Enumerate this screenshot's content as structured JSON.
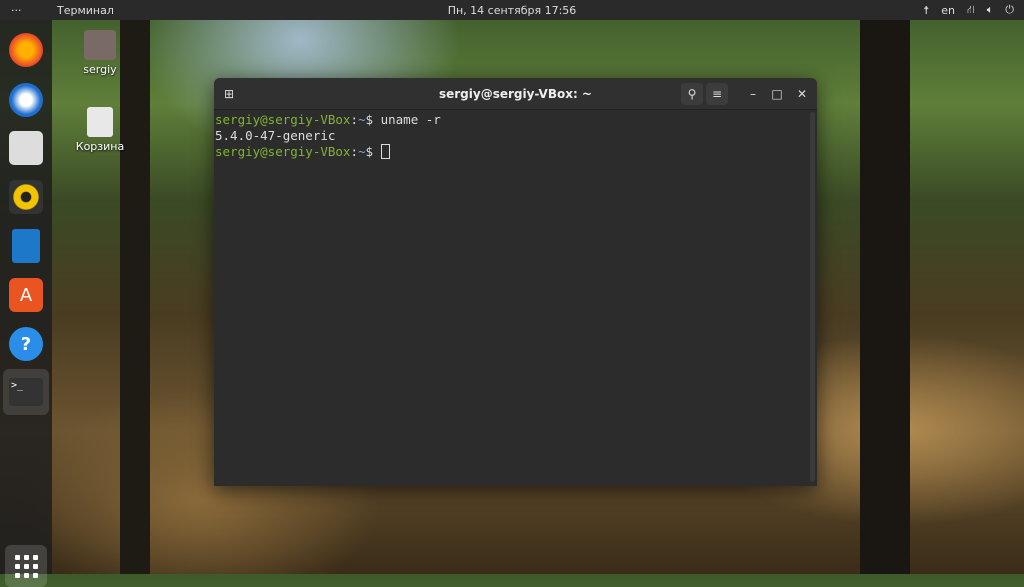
{
  "topbar": {
    "activities": "···",
    "app_name": "Терминал",
    "clock": "Пн, 14 сентября  17:56",
    "lang": "en"
  },
  "dock": {
    "items": [
      "firefox",
      "thunderbird",
      "files",
      "rhythmbox",
      "libreoffice-writer",
      "software",
      "help",
      "terminal"
    ]
  },
  "desktop": {
    "icons": [
      {
        "label": "sergiy"
      },
      {
        "label": "Корзина"
      }
    ]
  },
  "terminal": {
    "title": "sergiy@sergiy-VBox: ~",
    "lines": [
      {
        "user": "sergiy@sergiy-VBox",
        "path": "~",
        "prompt": "$",
        "cmd": "uname -r"
      },
      {
        "output": "5.4.0-47-generic"
      },
      {
        "user": "sergiy@sergiy-VBox",
        "path": "~",
        "prompt": "$",
        "cmd": ""
      }
    ],
    "colon": ":"
  },
  "colors": {
    "prompt_user": "#7fb62e",
    "prompt_path": "#88a7d1",
    "accent": "#e95420"
  }
}
